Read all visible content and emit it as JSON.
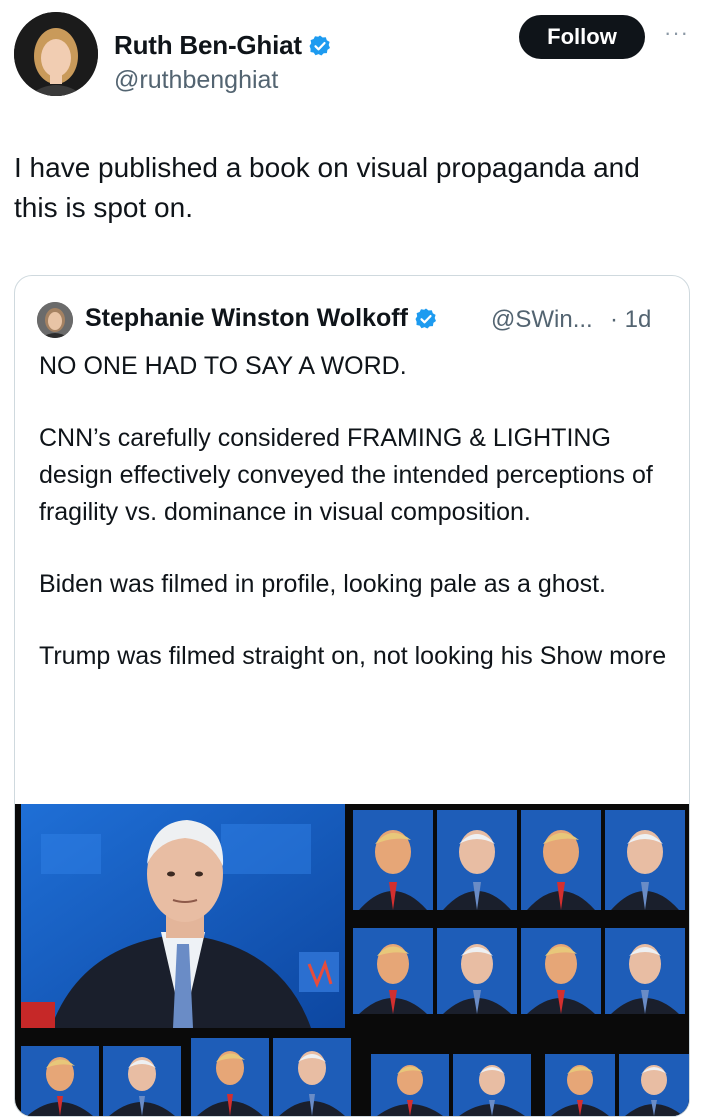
{
  "author": {
    "name": "Ruth Ben-Ghiat",
    "handle": "@ruthbenghiat",
    "verified_icon": "verified-badge-icon"
  },
  "follow_label": "Follow",
  "more_label": "···",
  "tweet_text": "I have published a book on visual propaganda and this is spot on.",
  "quote": {
    "name": "Stephanie Winston Wolkoff",
    "handle": "@SWin...",
    "time": "· 1d",
    "paragraphs": [
      "NO ONE HAD TO SAY A WORD.",
      "CNN’s carefully considered FRAMING & LIGHTING design effectively conveyed the intended perceptions of fragility vs. dominance in visual composition.",
      "Biden was filmed in profile, looking pale as a ghost."
    ],
    "last_paragraph": "Trump was filmed straight on, not looking his",
    "show_more": "Show more"
  },
  "colors": {
    "accent": "#0f1419",
    "verified": "#1d9bf0",
    "muted": "#536471",
    "border": "#cfd9de",
    "cnn_blue": "#1565c0"
  }
}
